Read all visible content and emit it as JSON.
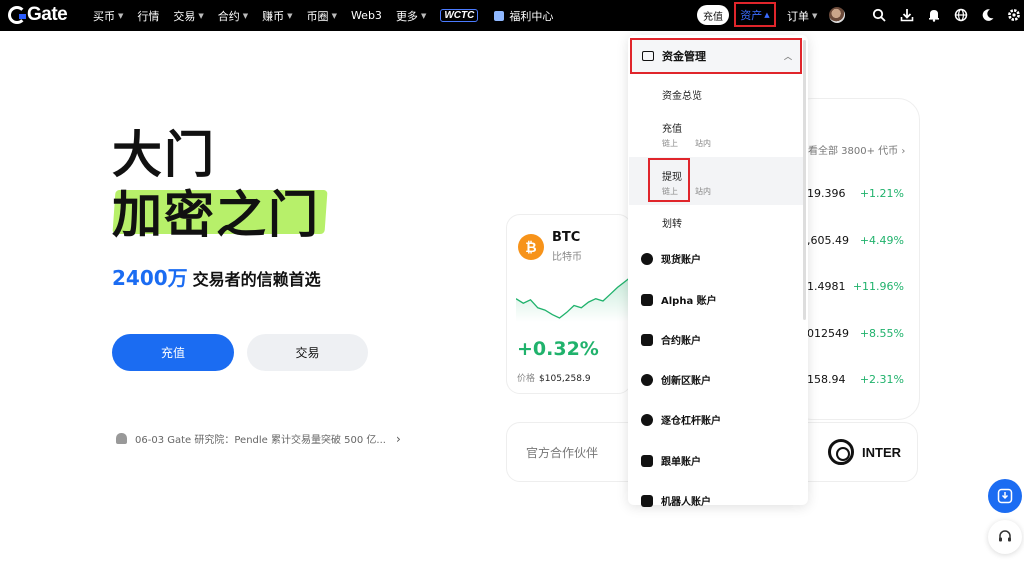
{
  "topbar": {
    "logo_text": "Gate",
    "nav": [
      {
        "label": "买币",
        "caret": true
      },
      {
        "label": "行情",
        "caret": false
      },
      {
        "label": "交易",
        "caret": true
      },
      {
        "label": "合约",
        "caret": true
      },
      {
        "label": "赚币",
        "caret": true
      },
      {
        "label": "币圈",
        "caret": true
      },
      {
        "label": "Web3",
        "caret": false
      },
      {
        "label": "更多",
        "caret": true
      }
    ],
    "promo_badge": "WCTC",
    "welfare": "福利中心",
    "deposit": "充值",
    "assets": "资产",
    "orders": "订单"
  },
  "hero": {
    "title_line1": "大门",
    "title_line2": "加密之门",
    "users_count": "2400万",
    "users_tagline": "交易者的信赖首选",
    "deposit_btn": "充值",
    "trade_btn": "交易",
    "announcement": "06-03 Gate 研究院：Pendle 累计交易量突破 500 亿..."
  },
  "market": {
    "view_all": "看全部 3800+ 代币",
    "rows": [
      {
        "price": "$19.396",
        "change": "+1.21%"
      },
      {
        "price": "2,605.49",
        "change": "+4.49%"
      },
      {
        "price": "$1.4981",
        "change": "+11.96%"
      },
      {
        "price": "0012549",
        "change": "+8.55%"
      },
      {
        "price": "$158.94",
        "change": "+2.31%"
      }
    ]
  },
  "btc_card": {
    "symbol": "BTC",
    "name": "比特币",
    "change": "+0.32%",
    "price_label": "价格",
    "price": "$105,258.9",
    "spark": [
      30,
      34,
      31,
      38,
      40,
      44,
      47,
      42,
      36,
      38,
      33,
      30,
      32,
      26,
      20,
      15,
      10
    ]
  },
  "partner": {
    "label": "官方合作伙伴",
    "name": "INTER"
  },
  "dropdown": {
    "header": "资金管理",
    "overview": "资金总览",
    "deposit": "充值",
    "deposit_onchain": "链上",
    "deposit_internal": "站内",
    "withdraw": "提现",
    "withdraw_onchain": "链上",
    "withdraw_internal": "站内",
    "transfer": "划转",
    "accounts": [
      "现货账户",
      "Alpha 账户",
      "合约账户",
      "创新区账户",
      "逐仓杠杆账户",
      "跟单账户",
      "机器人账户"
    ]
  },
  "colors": {
    "accent": "#1b6cf2",
    "up": "#20b26c",
    "highlight": "#b7f06a",
    "annotation": "#e0252b"
  }
}
